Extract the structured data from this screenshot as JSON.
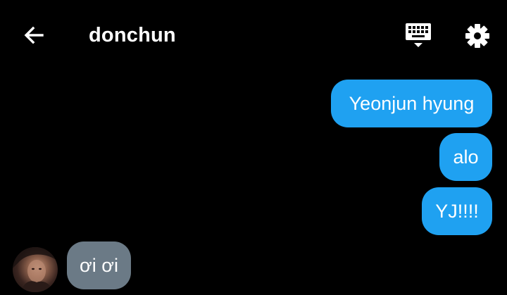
{
  "header": {
    "back_icon": "arrow-left-icon",
    "title": "donchun",
    "keyboard_icon": "keyboard-icon",
    "settings_icon": "gear-icon"
  },
  "messages": [
    {
      "direction": "sent",
      "text": "Yeonjun hyung"
    },
    {
      "direction": "sent",
      "text": "alo"
    },
    {
      "direction": "sent",
      "text": "YJ!!!!"
    },
    {
      "direction": "received",
      "text": "ơi ơi"
    }
  ],
  "colors": {
    "background": "#000000",
    "sent_bubble": "#1fa1f1",
    "received_bubble": "#6b7a86",
    "text": "#ffffff"
  }
}
